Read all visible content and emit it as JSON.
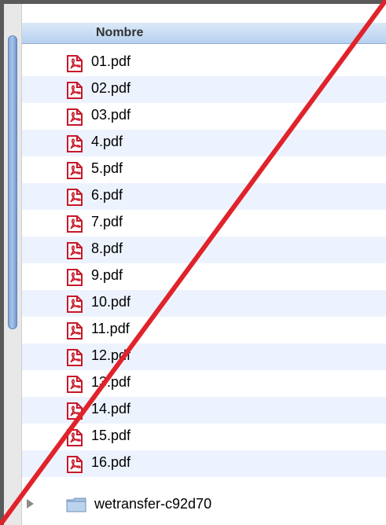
{
  "header": {
    "column_name": "Nombre"
  },
  "files": [
    {
      "name": "01.pdf"
    },
    {
      "name": "02.pdf"
    },
    {
      "name": "03.pdf"
    },
    {
      "name": "4.pdf"
    },
    {
      "name": "5.pdf"
    },
    {
      "name": "6.pdf"
    },
    {
      "name": "7.pdf"
    },
    {
      "name": "8.pdf"
    },
    {
      "name": "9.pdf"
    },
    {
      "name": "10.pdf"
    },
    {
      "name": "11.pdf"
    },
    {
      "name": "12.pdf"
    },
    {
      "name": "13.pdf"
    },
    {
      "name": "14.pdf"
    },
    {
      "name": "15.pdf"
    },
    {
      "name": "16.pdf"
    }
  ],
  "folder": {
    "name": "wetransfer-c92d70",
    "icon": "folder-icon"
  },
  "colors": {
    "strike_line": "#e0232b",
    "pdf_icon": "#c8182a",
    "row_alt": "#edf3fe",
    "header": "#b7d1ef"
  }
}
